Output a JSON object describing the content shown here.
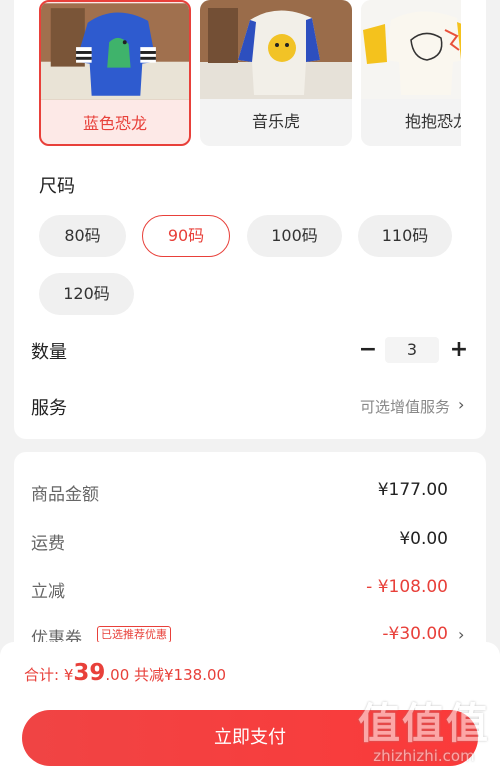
{
  "variants": {
    "items": [
      {
        "label": "蓝色恐龙",
        "selected": true
      },
      {
        "label": "音乐虎",
        "selected": false
      },
      {
        "label": "抱抱恐龙",
        "selected": false
      }
    ]
  },
  "size": {
    "title": "尺码",
    "options": [
      "80码",
      "90码",
      "100码",
      "110码",
      "120码"
    ],
    "selected": "90码"
  },
  "quantity": {
    "label": "数量",
    "minus": "−",
    "value": "3",
    "plus": "+"
  },
  "service": {
    "label": "服务",
    "value": "可选增值服务",
    "chevron": "›"
  },
  "summary": {
    "goods_label": "商品金额",
    "goods_value": "¥177.00",
    "shipping_label": "运费",
    "shipping_value": "¥0.00",
    "discount_label": "立减",
    "discount_value": "- ¥108.00",
    "coupon_label": "优惠券",
    "coupon_badge": "已选推荐优惠",
    "coupon_value": "-¥30.00",
    "coupon_chevron": "›"
  },
  "bottom": {
    "total_label": "合计: ",
    "currency": "¥",
    "total_int": "39",
    "total_dec": ".00",
    "total_saved": " 共减¥138.00",
    "pay_button": "立即支付"
  },
  "watermark": {
    "logo": "值",
    "text": "zhizhizhi.com"
  },
  "colors": {
    "accent": "#e8403a",
    "pay_button": "#f43f3f"
  }
}
